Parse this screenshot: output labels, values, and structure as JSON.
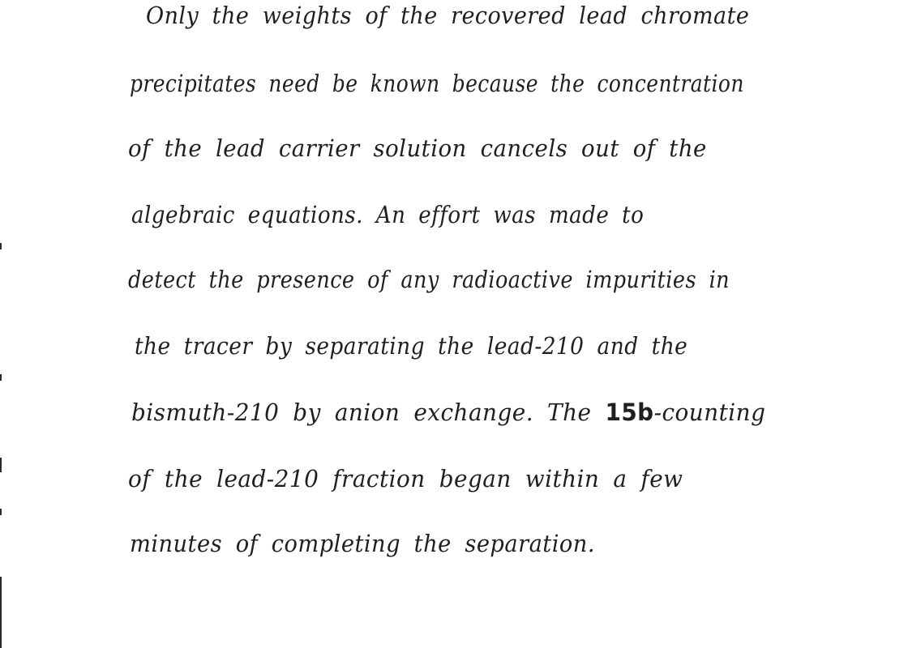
{
  "document": {
    "lines": [
      "Only the weights of the recovered lead chromate",
      "precipitates need be known because the concentration",
      "of the lead carrier solution cancels out of the",
      "algebraic equations. An effort was made to",
      "detect the presence of any radioactive impurities in",
      "the tracer by separating the lead-210 and the",
      "bismuth-210 by anion exchange. The",
      "of the lead-210 fraction began within a few",
      "minutes of completing the separation."
    ],
    "inline_bold": "15b",
    "inline_tail": "-counting"
  }
}
